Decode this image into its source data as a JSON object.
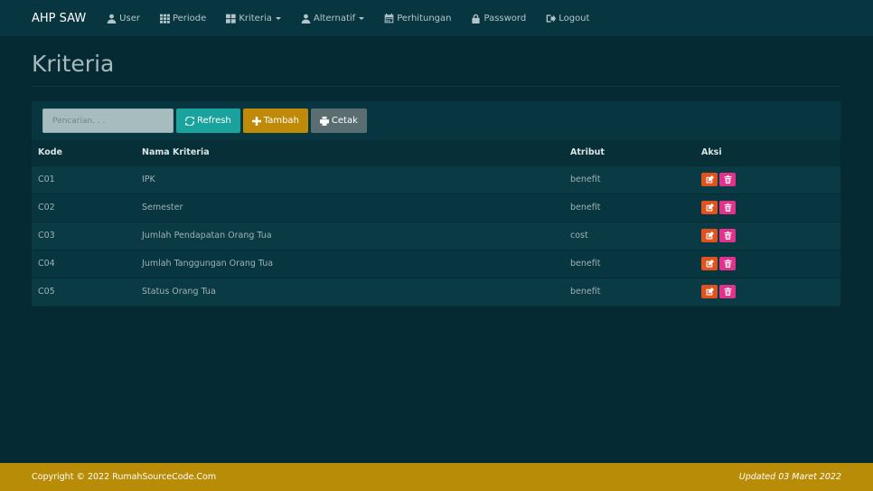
{
  "navbar": {
    "brand": "AHP SAW",
    "items": [
      {
        "label": "User",
        "icon": "user-icon",
        "dropdown": false
      },
      {
        "label": "Periode",
        "icon": "grid-icon",
        "dropdown": false
      },
      {
        "label": "Kriteria",
        "icon": "grid-large-icon",
        "dropdown": true
      },
      {
        "label": "Alternatif",
        "icon": "user-icon",
        "dropdown": true
      },
      {
        "label": "Perhitungan",
        "icon": "calendar-icon",
        "dropdown": false
      },
      {
        "label": "Password",
        "icon": "lock-icon",
        "dropdown": false
      },
      {
        "label": "Logout",
        "icon": "logout-icon",
        "dropdown": false
      }
    ]
  },
  "page": {
    "title": "Kriteria"
  },
  "toolbar": {
    "search_placeholder": "Pencarian. . .",
    "refresh_label": "Refresh",
    "tambah_label": "Tambah",
    "cetak_label": "Cetak"
  },
  "table": {
    "headers": [
      "Kode",
      "Nama Kriteria",
      "Atribut",
      "Aksi"
    ],
    "rows": [
      {
        "kode": "C01",
        "nama": "IPK",
        "atribut": "benefit"
      },
      {
        "kode": "C02",
        "nama": "Semester",
        "atribut": "benefit"
      },
      {
        "kode": "C03",
        "nama": "Jumlah Pendapatan Orang Tua",
        "atribut": "cost"
      },
      {
        "kode": "C04",
        "nama": "Jumlah Tanggungan Orang Tua",
        "atribut": "benefit"
      },
      {
        "kode": "C05",
        "nama": "Status Orang Tua",
        "atribut": "benefit"
      }
    ]
  },
  "footer": {
    "copyright": "Copyright © 2022 RumahSourceCode.Com",
    "updated": "Updated 03 Maret 2022"
  },
  "colors": {
    "background": "#052a33",
    "navbar": "#083640",
    "refresh": "#1aa39d",
    "tambah": "#bf8a08",
    "cetak": "#5a6e72",
    "edit": "#e0531f",
    "delete": "#e0338c",
    "footer": "#b98c08"
  }
}
